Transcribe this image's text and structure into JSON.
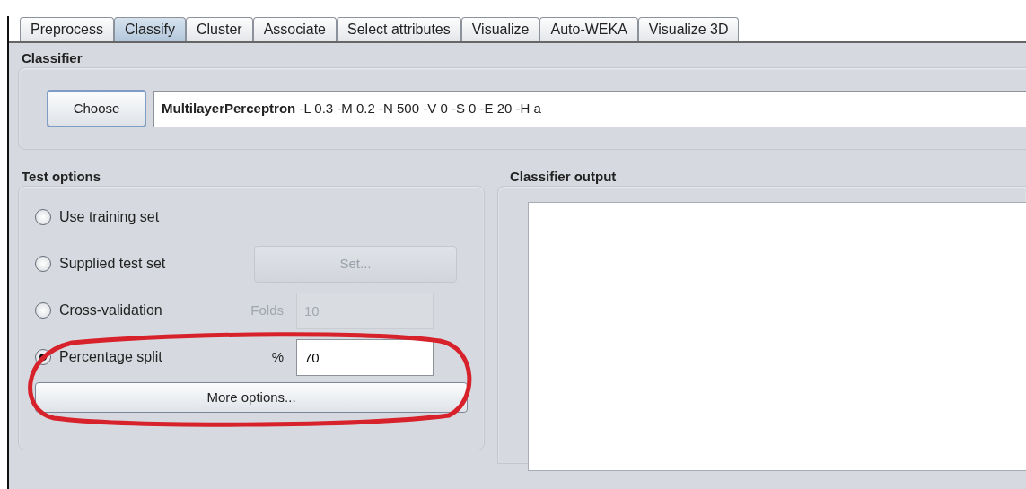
{
  "tabs": [
    {
      "label": "Preprocess",
      "selected": false
    },
    {
      "label": "Classify",
      "selected": true
    },
    {
      "label": "Cluster",
      "selected": false
    },
    {
      "label": "Associate",
      "selected": false
    },
    {
      "label": "Select attributes",
      "selected": false
    },
    {
      "label": "Visualize",
      "selected": false
    },
    {
      "label": "Auto-WEKA",
      "selected": false
    },
    {
      "label": "Visualize 3D",
      "selected": false
    }
  ],
  "classifier": {
    "title": "Classifier",
    "button": "Choose",
    "name": "MultilayerPerceptron",
    "options": "-L 0.3 -M 0.2 -N 500 -V 0 -S 0 -E 20 -H a"
  },
  "test_options": {
    "title": "Test options",
    "options": [
      {
        "kind": "plain",
        "label": "Use training set",
        "selected": false
      },
      {
        "kind": "button",
        "label": "Supplied test set",
        "selected": false,
        "button": "Set...",
        "disabled": true
      },
      {
        "kind": "field",
        "label": "Cross-validation",
        "selected": false,
        "field_label": "Folds",
        "value": "10",
        "disabled": true
      },
      {
        "kind": "field",
        "label": "Percentage split",
        "selected": true,
        "field_label": "%",
        "value": "70",
        "disabled": false
      }
    ],
    "more_button": "More options..."
  },
  "output": {
    "title": "Classifier output"
  }
}
